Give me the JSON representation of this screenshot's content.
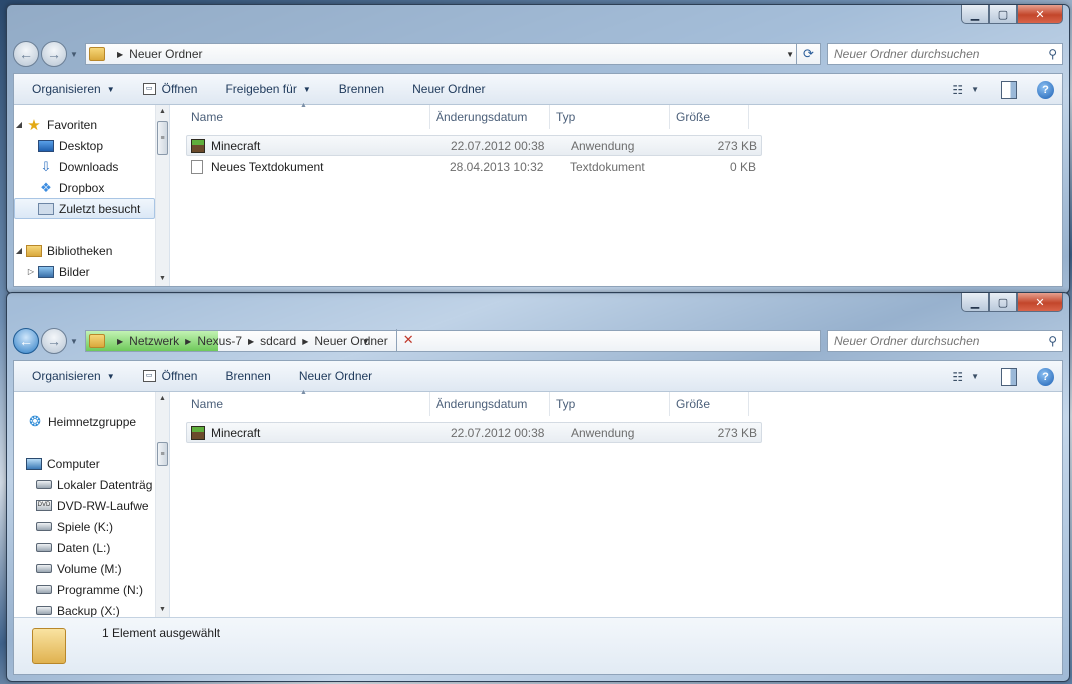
{
  "window1": {
    "breadcrumbs": [
      "Neuer Ordner"
    ],
    "search_placeholder": "Neuer Ordner durchsuchen",
    "toolbar": {
      "organize": "Organisieren",
      "open": "Öffnen",
      "share": "Freigeben für",
      "burn": "Brennen",
      "new_folder": "Neuer Ordner"
    },
    "nav": {
      "favorites": "Favoriten",
      "desktop": "Desktop",
      "downloads": "Downloads",
      "dropbox": "Dropbox",
      "recent": "Zuletzt besucht",
      "libraries": "Bibliotheken",
      "pictures": "Bilder"
    },
    "columns": {
      "name": "Name",
      "date": "Änderungsdatum",
      "type": "Typ",
      "size": "Größe"
    },
    "files": [
      {
        "name": "Minecraft",
        "date": "22.07.2012 00:38",
        "type": "Anwendung",
        "size": "273 KB",
        "icon": "minecraft-icon"
      },
      {
        "name": "Neues Textdokument",
        "date": "28.04.2013 10:32",
        "type": "Textdokument",
        "size": "0 KB",
        "icon": "text-document-icon"
      }
    ]
  },
  "window2": {
    "breadcrumbs": [
      "Netzwerk",
      "Nexus-7",
      "sdcard",
      "Neuer Ordner"
    ],
    "search_placeholder": "Neuer Ordner durchsuchen",
    "toolbar": {
      "organize": "Organisieren",
      "open": "Öffnen",
      "burn": "Brennen",
      "new_folder": "Neuer Ordner"
    },
    "nav": {
      "homegroup": "Heimnetzgruppe",
      "computer": "Computer",
      "local_drive": "Lokaler Datenträg",
      "dvd_drive": "DVD-RW-Laufwe",
      "games": "Spiele (K:)",
      "data": "Daten (L:)",
      "volume": "Volume (M:)",
      "programs": "Programme (N:)",
      "backup": "Backup (X:)"
    },
    "columns": {
      "name": "Name",
      "date": "Änderungsdatum",
      "type": "Typ",
      "size": "Größe"
    },
    "files": [
      {
        "name": "Minecraft",
        "date": "22.07.2012 00:38",
        "type": "Anwendung",
        "size": "273 KB",
        "icon": "minecraft-icon"
      }
    ],
    "status": "1 Element ausgewählt"
  },
  "colors": {
    "address_progress": "#58c23f",
    "close_button": "#c3462b",
    "selection_border": "#a9c5e4"
  }
}
